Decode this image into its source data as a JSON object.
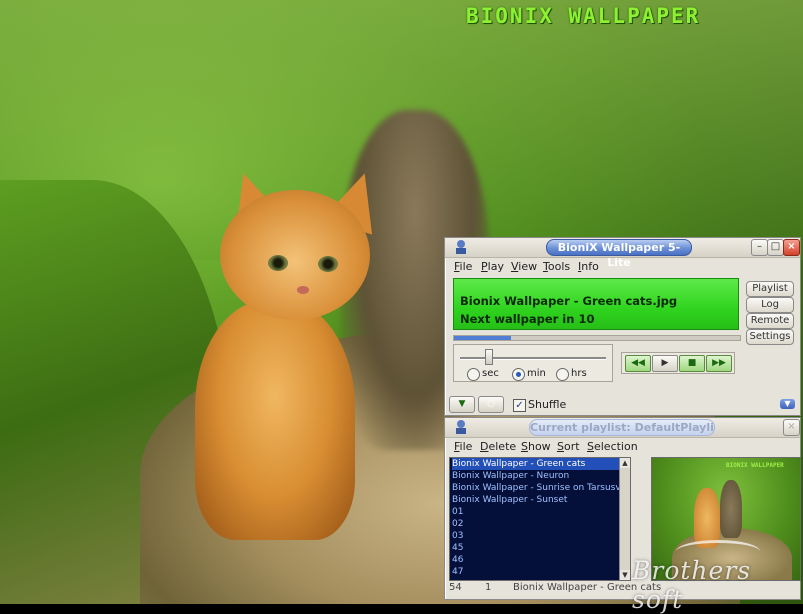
{
  "wallpaper": {
    "title": "BIONIX WALLPAPER"
  },
  "player": {
    "title": "BioniX Wallpaper 5-Lite",
    "menu": [
      "File",
      "Play",
      "View",
      "Tools",
      "Info"
    ],
    "display": {
      "line1": "Bionix Wallpaper - Green cats.jpg",
      "line2": "Next wallpaper in 10"
    },
    "side_buttons": [
      "Playlist",
      "Log",
      "Remote",
      "Settings"
    ],
    "progress_fraction": 0.2,
    "interval_slider_fraction": 0.18,
    "units": [
      {
        "label": "sec",
        "selected": false
      },
      {
        "label": "min",
        "selected": true
      },
      {
        "label": "hrs",
        "selected": false
      }
    ],
    "transport": [
      "previous-icon",
      "play-icon",
      "stop-icon",
      "next-icon"
    ],
    "shuffle_label": "Shuffle",
    "shuffle_checked": true
  },
  "playlist": {
    "title": "Current playlist: DefaultPlayli...",
    "menu": [
      "File",
      "Delete",
      "Show",
      "Sort",
      "Selection"
    ],
    "items": [
      "Bionix Wallpaper - Green cats",
      "Bionix Wallpaper - Neuron",
      "Bionix Wallpaper - Sunrise on Tarsusv",
      "Bionix Wallpaper - Sunset",
      "01",
      "02",
      "03",
      "45",
      "46",
      "47"
    ],
    "selected_index": 0,
    "status": {
      "count": "54",
      "index": "1",
      "current": "Bionix Wallpaper - Green cats"
    }
  },
  "watermark": "Brothers soft",
  "colors": {
    "display_green": "#2fd41e",
    "title_blue": "#4a71c4",
    "list_bg": "#05103a",
    "brand_green": "#8ef034"
  }
}
